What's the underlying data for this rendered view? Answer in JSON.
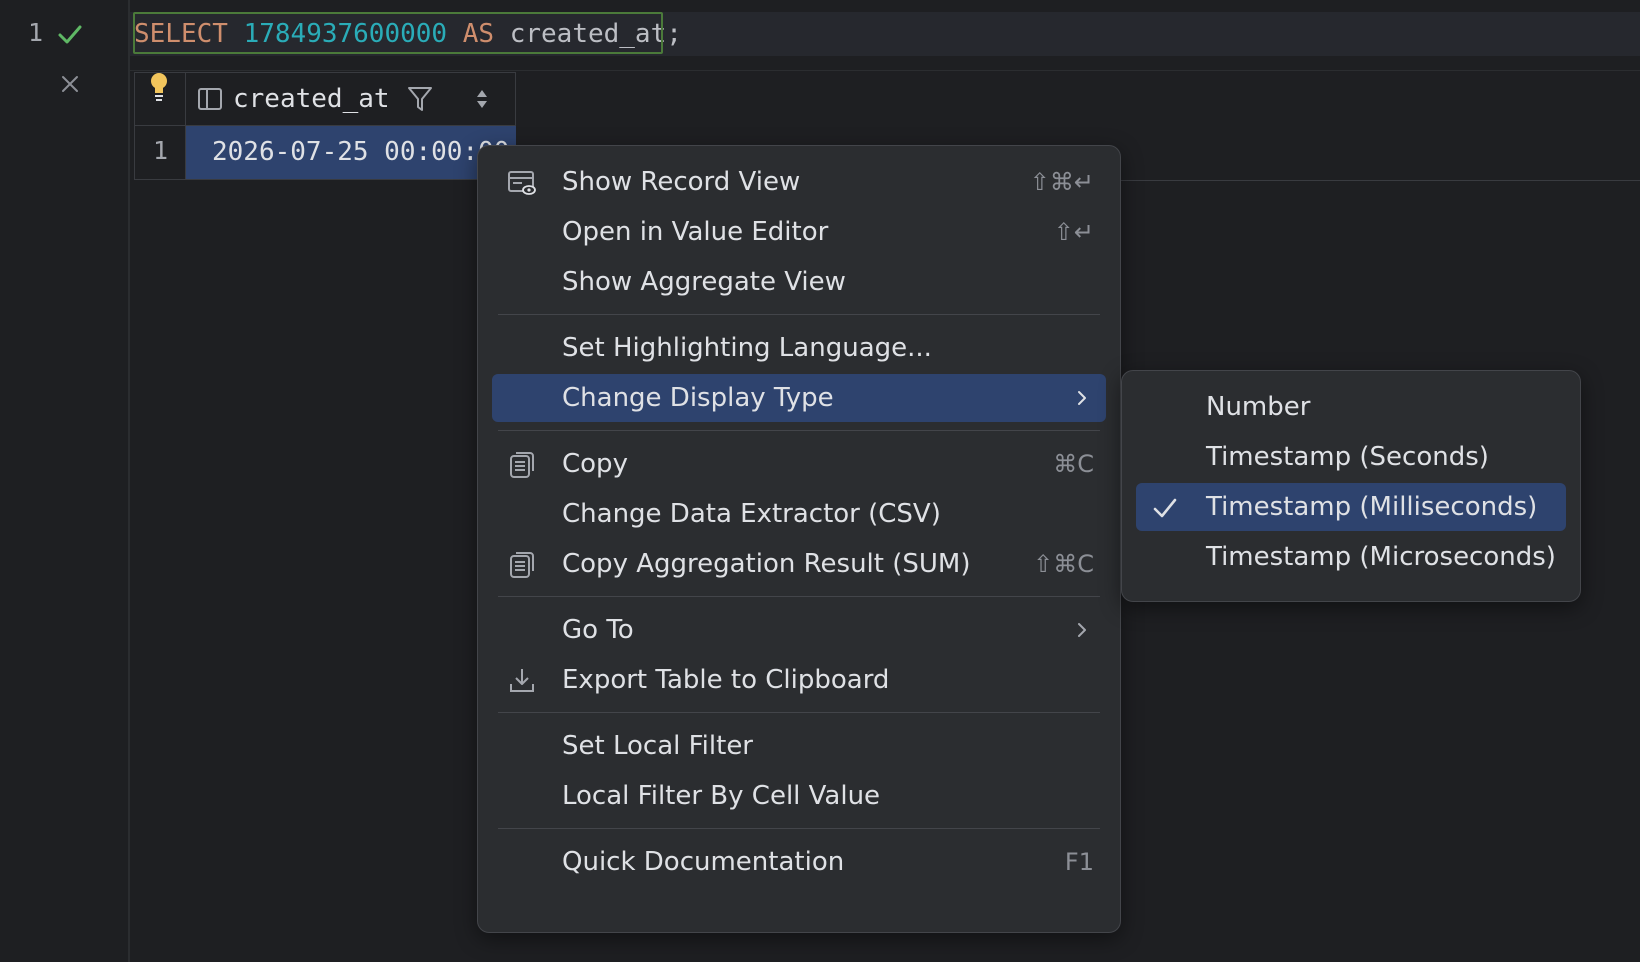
{
  "editor": {
    "line_number": "1",
    "code": {
      "kw_select": "SELECT",
      "number": "1784937600000",
      "kw_as": "AS",
      "ident": "created_at",
      "semicolon": ";"
    }
  },
  "results": {
    "column_header": "created_at",
    "row_number": "1",
    "cell_value": "2026-07-25 00:00:00"
  },
  "context_menu": {
    "show_record_view": {
      "label": "Show Record View",
      "shortcut": "⇧⌘↵"
    },
    "open_value_editor": {
      "label": "Open in Value Editor",
      "shortcut": "⇧↵"
    },
    "show_aggregate_view": {
      "label": "Show Aggregate View"
    },
    "set_highlighting_language": {
      "label": "Set Highlighting Language..."
    },
    "change_display_type": {
      "label": "Change Display Type"
    },
    "copy": {
      "label": "Copy",
      "shortcut": "⌘C"
    },
    "change_data_extractor": {
      "label": "Change Data Extractor (CSV)"
    },
    "copy_aggregation_result": {
      "label": "Copy Aggregation Result (SUM)",
      "shortcut": "⇧⌘C"
    },
    "go_to": {
      "label": "Go To"
    },
    "export_table": {
      "label": "Export Table to Clipboard"
    },
    "set_local_filter": {
      "label": "Set Local Filter"
    },
    "local_filter_by_cell": {
      "label": "Local Filter By Cell Value"
    },
    "quick_documentation": {
      "label": "Quick Documentation",
      "shortcut": "F1"
    }
  },
  "display_type_submenu": {
    "number": "Number",
    "timestamp_seconds": "Timestamp (Seconds)",
    "timestamp_milliseconds": "Timestamp (Milliseconds)",
    "timestamp_microseconds": "Timestamp (Microseconds)",
    "selected": "Timestamp (Milliseconds)"
  },
  "colors": {
    "background": "#1e1f22",
    "menu_background": "#2b2d30",
    "selection": "#2e436e",
    "keyword": "#cf8e6d",
    "number": "#2aacb8",
    "success": "#5fb865"
  }
}
